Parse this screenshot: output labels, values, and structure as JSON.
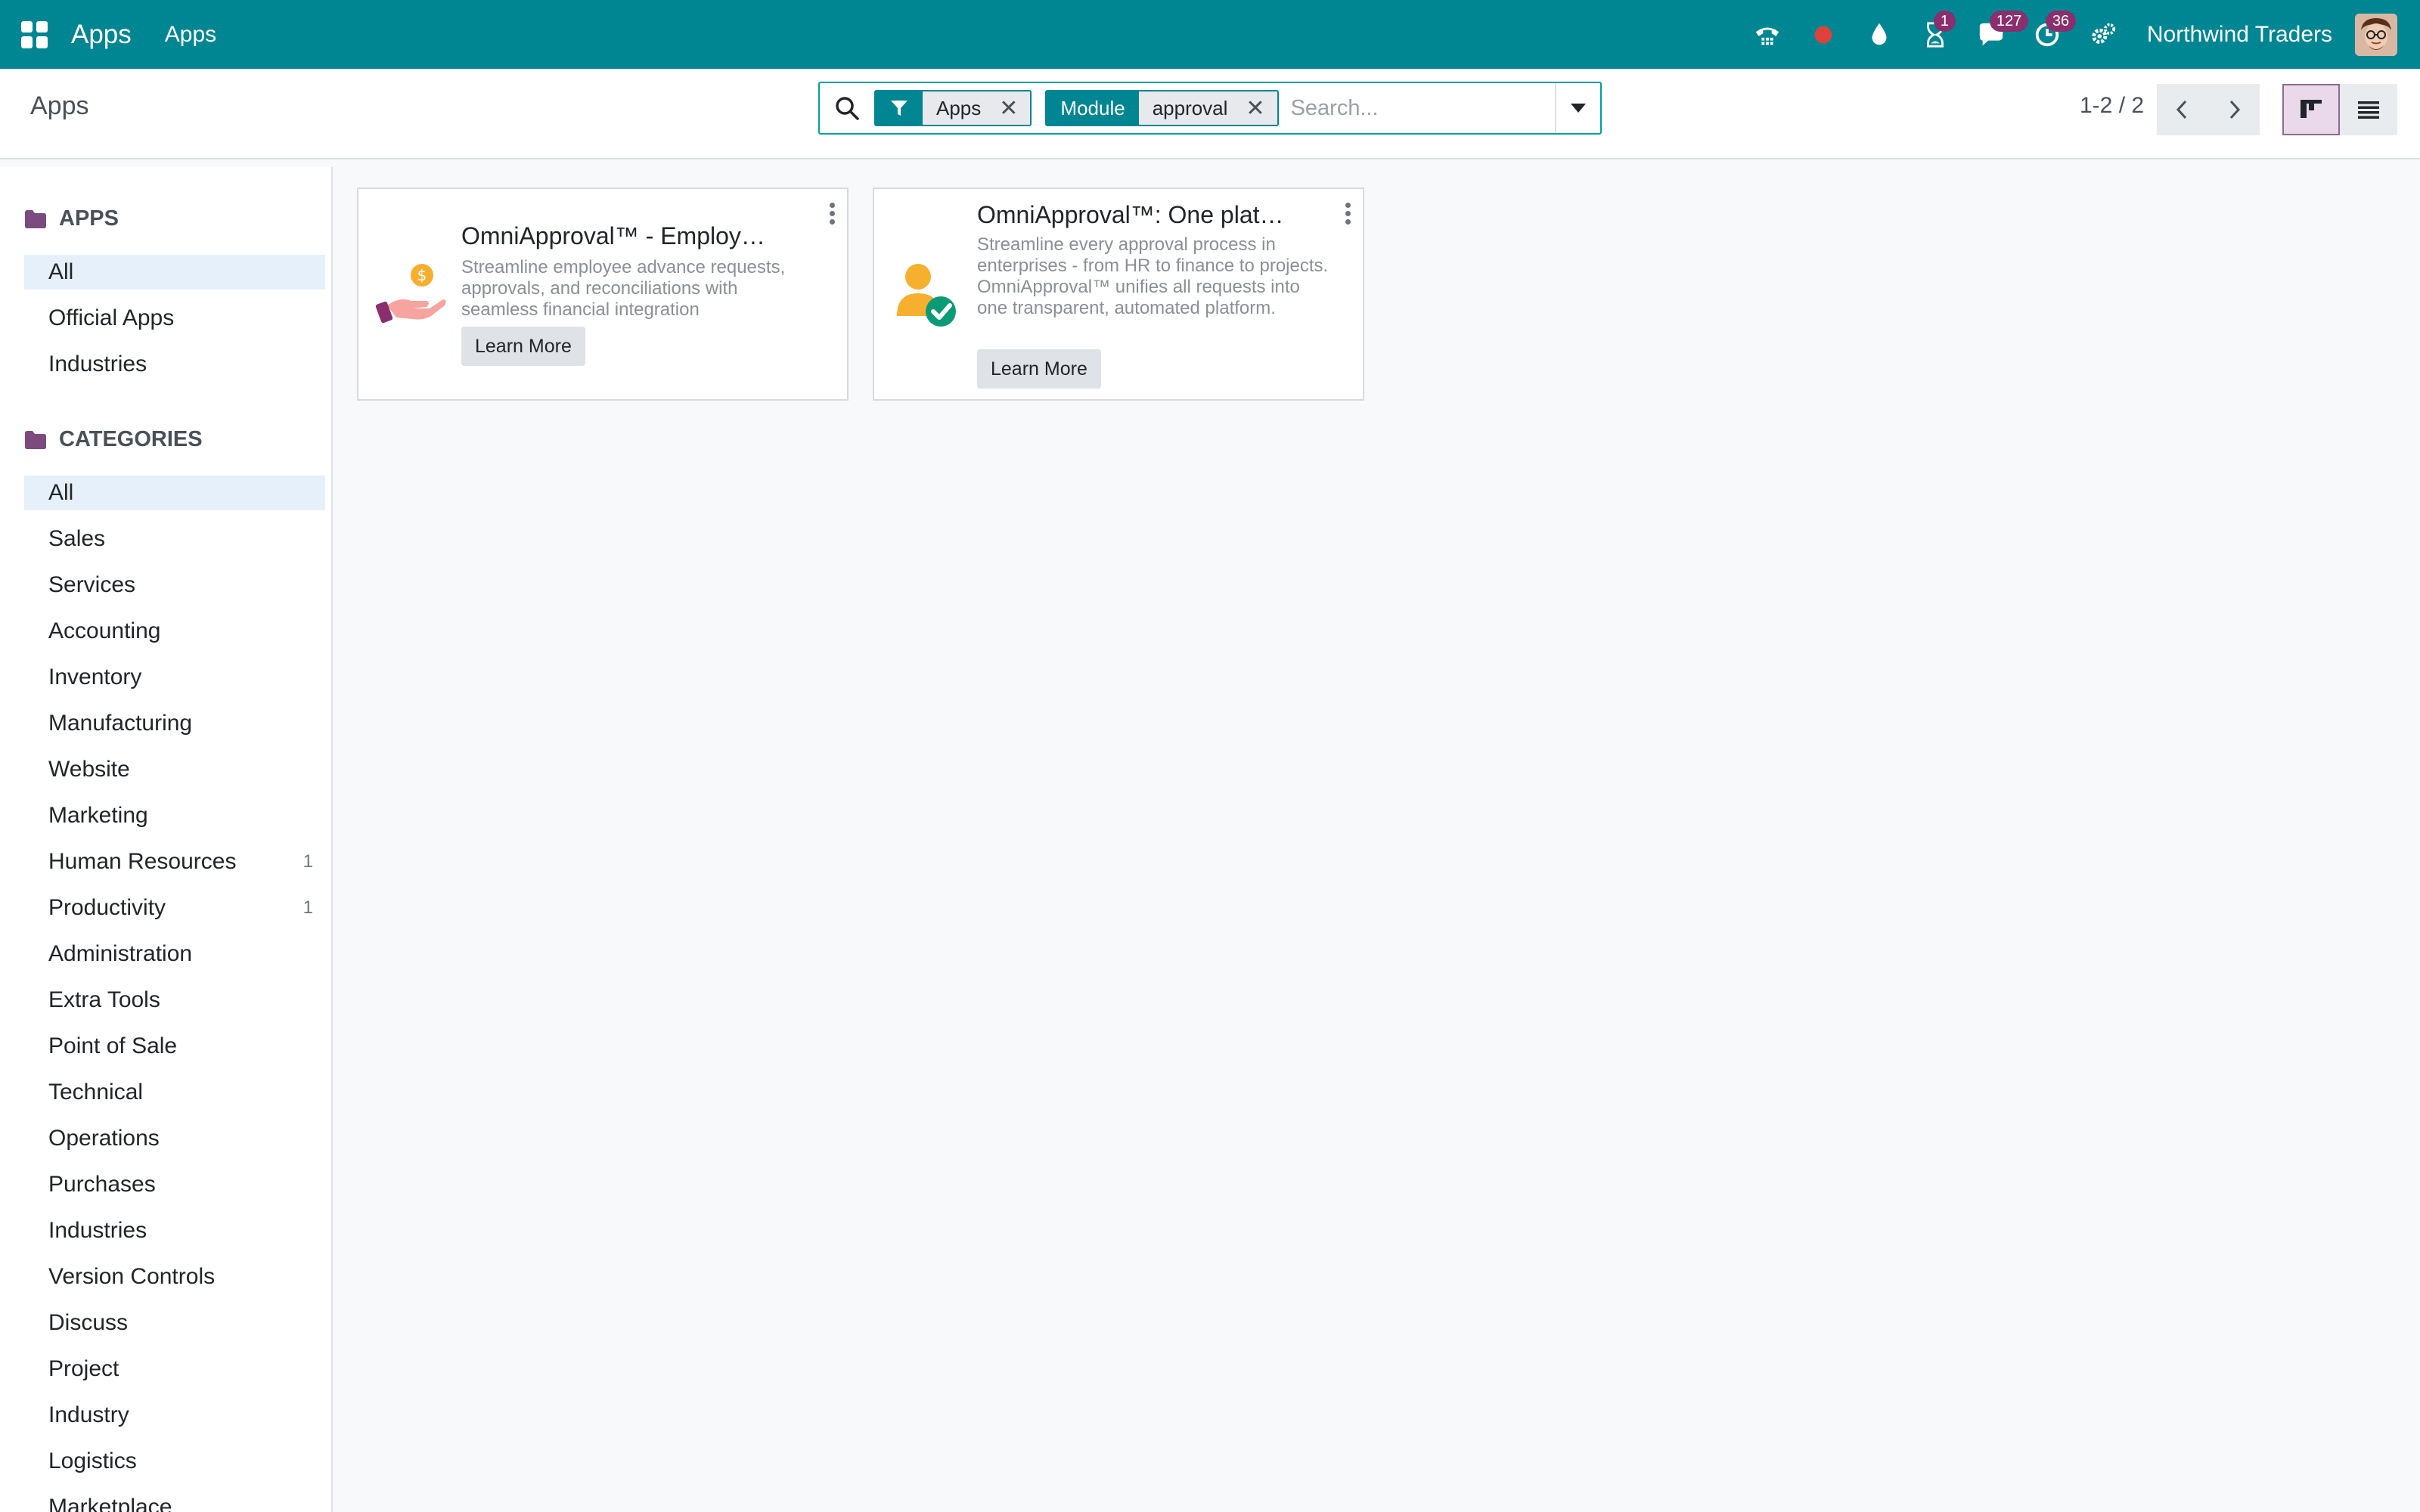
{
  "navbar": {
    "brand": "Apps",
    "menu_apps": "Apps",
    "icons": [
      "phone-icon",
      "recording-dot-icon",
      "drop-icon",
      "hourglass-icon",
      "chat-icon",
      "clock-icon",
      "settings-icon"
    ],
    "activity_badge": "1",
    "messages_badge": "127",
    "clock_badge": "36",
    "company": "Northwind Traders",
    "colors": {
      "bar": "#008592",
      "badge": "#8a2f6e"
    }
  },
  "control_panel": {
    "breadcrumb": "Apps",
    "search": {
      "facets": [
        {
          "type": "filter",
          "label_icon": "filter-icon",
          "value": "Apps"
        },
        {
          "type": "field",
          "label": "Module",
          "value": "approval"
        }
      ],
      "placeholder": "Search..."
    },
    "pager": "1-2 / 2",
    "views": [
      "kanban-view",
      "list-view"
    ]
  },
  "sidebar": {
    "apps_header": "APPS",
    "apps_items": [
      {
        "label": "All",
        "active": true
      },
      {
        "label": "Official Apps"
      },
      {
        "label": "Industries"
      }
    ],
    "categories_header": "CATEGORIES",
    "category_items": [
      {
        "label": "All",
        "active": true,
        "count": ""
      },
      {
        "label": "Sales",
        "count": ""
      },
      {
        "label": "Services",
        "count": ""
      },
      {
        "label": "Accounting",
        "count": ""
      },
      {
        "label": "Inventory",
        "count": ""
      },
      {
        "label": "Manufacturing",
        "count": ""
      },
      {
        "label": "Website",
        "count": ""
      },
      {
        "label": "Marketing",
        "count": ""
      },
      {
        "label": "Human Resources",
        "count": "1"
      },
      {
        "label": "Productivity",
        "count": "1"
      },
      {
        "label": "Administration",
        "count": ""
      },
      {
        "label": "Extra Tools",
        "count": ""
      },
      {
        "label": "Point of Sale",
        "count": ""
      },
      {
        "label": "Technical",
        "count": ""
      },
      {
        "label": "Operations",
        "count": ""
      },
      {
        "label": "Purchases",
        "count": ""
      },
      {
        "label": "Industries",
        "count": ""
      },
      {
        "label": "Version Controls",
        "count": ""
      },
      {
        "label": "Discuss",
        "count": ""
      },
      {
        "label": "Project",
        "count": ""
      },
      {
        "label": "Industry",
        "count": ""
      },
      {
        "label": "Logistics",
        "count": ""
      },
      {
        "label": "Marketplace",
        "count": ""
      }
    ]
  },
  "cards": [
    {
      "title": "OmniApproval™ - Employ…",
      "description": "Streamline employee advance requests, approvals, and reconciliations with seamless financial integration",
      "button": "Learn More",
      "icon": "hand-coin-icon"
    },
    {
      "title": "OmniApproval™: One plat…",
      "description": "Streamline every approval process in enterprises - from HR to finance to projects. OmniApproval™ unifies all requests into one transparent, automated platform.",
      "button": "Learn More",
      "icon": "user-check-icon"
    }
  ]
}
